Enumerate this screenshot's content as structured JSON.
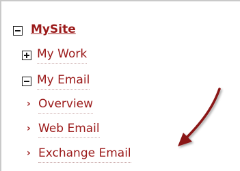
{
  "tree": {
    "root": {
      "label": "MySite",
      "state": "expanded"
    },
    "items": [
      {
        "label": "My Work",
        "state": "collapsed"
      },
      {
        "label": "My Email",
        "state": "expanded"
      }
    ],
    "email_children": [
      {
        "label": "Overview"
      },
      {
        "label": "Web Email"
      },
      {
        "label": "Exchange Email"
      }
    ]
  },
  "colors": {
    "link": "#9b1a1a",
    "arrow": "#8a1616",
    "border": "#c9c9c9"
  },
  "icons": {
    "expanded": "minus-box-icon",
    "collapsed": "plus-box-icon",
    "bullet": "chevron-right-icon",
    "annotation": "arrow-icon"
  }
}
